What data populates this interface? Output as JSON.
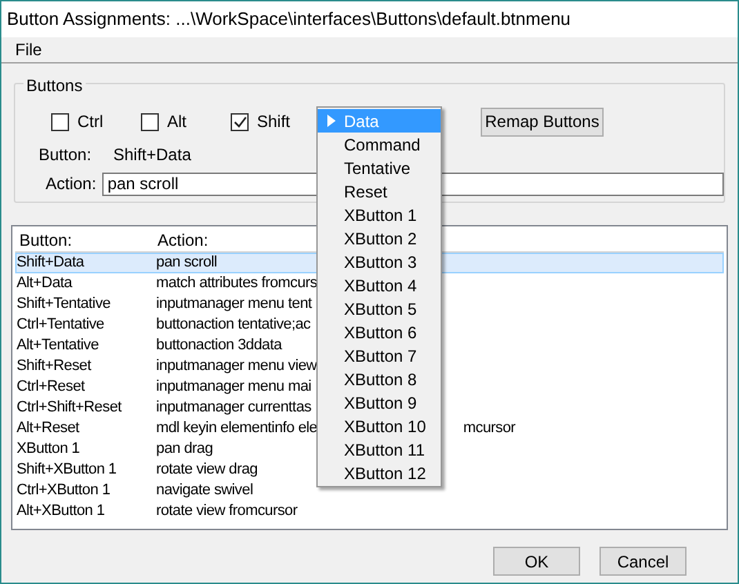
{
  "window": {
    "title": "Button Assignments: ...\\WorkSpace\\interfaces\\Buttons\\default.btnmenu"
  },
  "menu_bar": [
    "File"
  ],
  "buttons_group": {
    "title": "Buttons",
    "modifiers": [
      {
        "label": "Ctrl",
        "checked": false
      },
      {
        "label": "Alt",
        "checked": false
      },
      {
        "label": "Shift",
        "checked": true
      }
    ],
    "remap_button": "Remap Buttons",
    "button_label": "Button:",
    "button_value": "Shift+Data",
    "action_label": "Action:",
    "action_value": "pan scroll"
  },
  "table": {
    "columns": [
      "Button:",
      "Action:"
    ],
    "rows": [
      {
        "button": "Shift+Data",
        "action": "pan scroll",
        "selected": true
      },
      {
        "button": "Alt+Data",
        "action": "match attributes fromcurs",
        "selected": false
      },
      {
        "button": "Shift+Tentative",
        "action": "inputmanager menu tent",
        "selected": false
      },
      {
        "button": "Ctrl+Tentative",
        "action": "buttonaction tentative;ac",
        "selected": false
      },
      {
        "button": "Alt+Tentative",
        "action": "buttonaction 3ddata",
        "selected": false
      },
      {
        "button": "Shift+Reset",
        "action": "inputmanager menu view",
        "selected": false
      },
      {
        "button": "Ctrl+Reset",
        "action": "inputmanager menu mai",
        "selected": false
      },
      {
        "button": "Ctrl+Shift+Reset",
        "action": "inputmanager currenttas",
        "selected": false
      },
      {
        "button": "Alt+Reset",
        "action": "mdl keyin elementinfo ele",
        "action_tail": "mcursor",
        "selected": false
      },
      {
        "button": "XButton 1",
        "action": "pan drag",
        "selected": false
      },
      {
        "button": "Shift+XButton 1",
        "action": "rotate view drag",
        "selected": false
      },
      {
        "button": "Ctrl+XButton 1",
        "action": "navigate swivel",
        "selected": false
      },
      {
        "button": "Alt+XButton 1",
        "action": "rotate view fromcursor",
        "selected": false
      }
    ]
  },
  "dropdown": [
    {
      "label": "Data",
      "selected": true
    },
    {
      "label": "Command",
      "selected": false
    },
    {
      "label": "Tentative",
      "selected": false
    },
    {
      "label": "Reset",
      "selected": false
    },
    {
      "label": "XButton 1",
      "selected": false
    },
    {
      "label": "XButton 2",
      "selected": false
    },
    {
      "label": "XButton 3",
      "selected": false
    },
    {
      "label": "XButton 4",
      "selected": false
    },
    {
      "label": "XButton 5",
      "selected": false
    },
    {
      "label": "XButton 6",
      "selected": false
    },
    {
      "label": "XButton 7",
      "selected": false
    },
    {
      "label": "XButton 8",
      "selected": false
    },
    {
      "label": "XButton 9",
      "selected": false
    },
    {
      "label": "XButton 10",
      "selected": false
    },
    {
      "label": "XButton 11",
      "selected": false
    },
    {
      "label": "XButton 12",
      "selected": false
    }
  ],
  "dialog_buttons": [
    "OK",
    "Cancel"
  ]
}
